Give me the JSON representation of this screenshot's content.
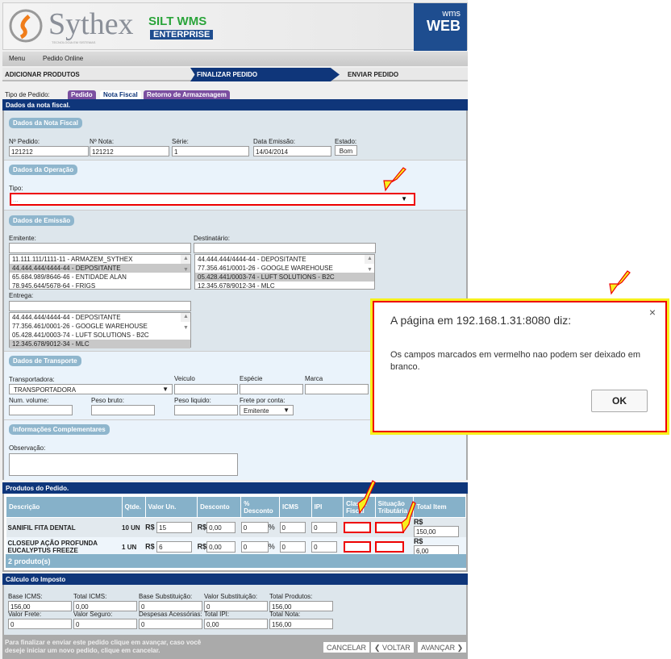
{
  "header": {
    "brand": "Sythex",
    "brand_sub": "TECNOLOGIA EM SISTEMAS",
    "product": "SILT WMS",
    "edition": "ENTERPRISE",
    "badge_top": "wms",
    "badge_bottom": "WEB"
  },
  "breadcrumb": [
    "Menu",
    "Pedido Online"
  ],
  "steps": [
    "ADICIONAR PRODUTOS",
    "FINALIZAR PEDIDO",
    "ENVIAR PEDIDO"
  ],
  "order_type": {
    "label": "Tipo de Pedido:",
    "tabs": [
      "Pedido",
      "Nota Fiscal",
      "Retorno de Armazenagem"
    ]
  },
  "section_title": "Dados da nota fiscal.",
  "nota": {
    "legend": "Dados da Nota Fiscal",
    "fields": [
      {
        "label": "Nº Pedido:",
        "value": "121212"
      },
      {
        "label": "Nº Nota:",
        "value": "121212"
      },
      {
        "label": "Série:",
        "value": "1"
      },
      {
        "label": "Data Emissão:",
        "value": "14/04/2014"
      },
      {
        "label": "Estado:",
        "value": "Bom"
      }
    ]
  },
  "operacao": {
    "legend": "Dados da Operação",
    "tipo_label": "Tipo:",
    "tipo_value": "..."
  },
  "emissao": {
    "legend": "Dados de Emissão",
    "emitente_label": "Emitente:",
    "emitente": [
      "11.111.111/1111-11 - ARMAZEM_SYTHEX",
      "44.444.444/4444-44 - DEPOSITANTE",
      "65.684.989/8646-46 - ENTIDADE ALAN",
      "78.945.644/5678-64 - FRIGS"
    ],
    "destinatario_label": "Destinatário:",
    "destinatario": [
      "44.444.444/4444-44 - DEPOSITANTE",
      "77.356.461/0001-26 - GOOGLE WAREHOUSE",
      "05.428.441/0003-74 - LUFT SOLUTIONS - B2C",
      "12.345.678/9012-34 - MLC"
    ],
    "entrega_label": "Entrega:",
    "entrega": [
      "44.444.444/4444-44 - DEPOSITANTE",
      "77.356.461/0001-26 - GOOGLE WAREHOUSE",
      "05.428.441/0003-74 - LUFT SOLUTIONS - B2C",
      "12.345.678/9012-34 - MLC"
    ]
  },
  "transporte": {
    "legend": "Dados de Transporte",
    "transportadora_label": "Transportadora:",
    "transportadora_value": "TRANSPORTADORA",
    "veiculo": "Veiculo",
    "especie": "Espécie",
    "marca": "Marca",
    "num_volume": "Num. volume:",
    "peso_bruto": "Peso bruto:",
    "peso_liquido": "Peso liquido:",
    "frete_label": "Frete por conta:",
    "frete_value": "Emitente"
  },
  "complementares": {
    "legend": "Informações Complementares",
    "obs_label": "Observação:"
  },
  "produtos": {
    "title": "Produtos do Pedido.",
    "headers": [
      "Descrição",
      "Qtde.",
      "Valor Un.",
      "Desconto",
      "% Desconto",
      "ICMS",
      "IPI",
      "Classi. Fiscal",
      "Situação Tributária",
      "Total Item"
    ],
    "rows": [
      {
        "desc": "SANIFIL FITA DENTAL",
        "qtde": "10 UN",
        "valor": "15",
        "desconto": "0,00",
        "pct": "0",
        "icms": "0",
        "ipi": "0",
        "total": "150,00"
      },
      {
        "desc": "CLOSEUP AÇÃO PROFUNDA EUCALYPTUS FREEZE",
        "qtde": "1 UN",
        "valor": "6",
        "desconto": "0,00",
        "pct": "0",
        "icms": "0",
        "ipi": "0",
        "total": "6,00"
      }
    ],
    "currency": "R$",
    "pct_sign": "%",
    "count": "2 produto(s)"
  },
  "imposto": {
    "title": "Cálculo do Imposto",
    "fields": [
      {
        "label": "Base ICMS:",
        "value": "156,00"
      },
      {
        "label": "Total ICMS:",
        "value": "0,00"
      },
      {
        "label": "Base Substituição:",
        "value": "0"
      },
      {
        "label": "Valor Substituição:",
        "value": "0"
      },
      {
        "label": "Total Produtos:",
        "value": "156,00"
      },
      {
        "label": "Valor Frete:",
        "value": "0"
      },
      {
        "label": "Valor Seguro:",
        "value": "0"
      },
      {
        "label": "Despesas Acessórias:",
        "value": "0"
      },
      {
        "label": "Total IPI:",
        "value": "0,00"
      },
      {
        "label": "Total Nota:",
        "value": "156,00"
      }
    ]
  },
  "footer": {
    "hint": "Para finalizar e enviar este pedido clique em avançar, caso você deseje iniciar um novo pedido, clique em cancelar.",
    "cancel": "CANCELAR",
    "back": "❮ VOLTAR",
    "next": "AVANÇAR ❯"
  },
  "dialog": {
    "title": "A página em 192.168.1.31:8080 diz:",
    "message": "Os campos marcados em vermelho nao podem ser deixado em branco.",
    "ok": "OK",
    "close": "×"
  }
}
